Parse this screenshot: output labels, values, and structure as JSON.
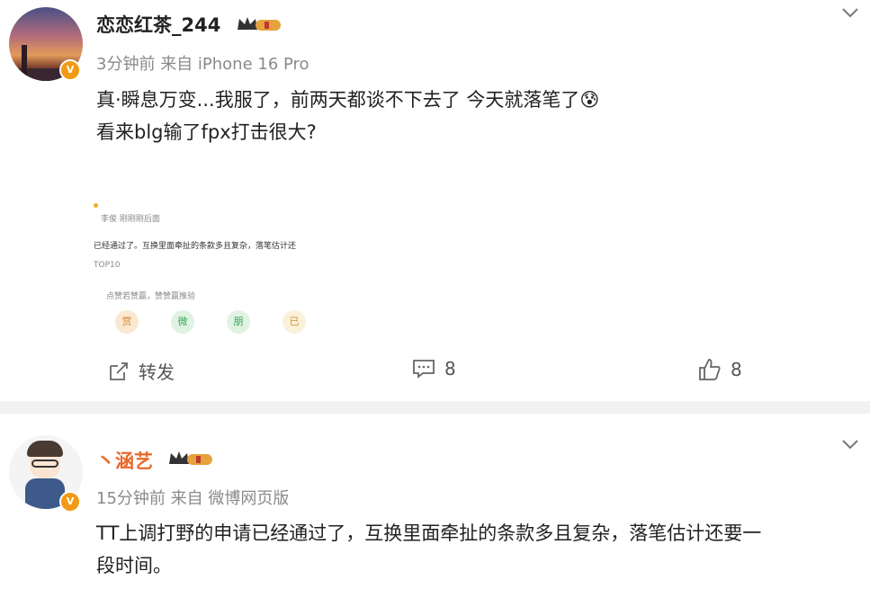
{
  "post1": {
    "username": "恋恋红茶_244",
    "time": "3分钟前",
    "source": "来自 iPhone 16 Pro",
    "line1": "真·瞬息万变...我服了，前两天都谈不下去了 今天就落笔了",
    "line2": "看来blg输了fpx打击很大?",
    "emoji": "😰",
    "thumbnail": {
      "line_a": "李俊 刚刚刚后面",
      "line_b": "已经通过了。互换里面牵扯的条款多且复杂，落笔估计还",
      "line_c": "TOP10",
      "line_d": "点赞若赞赢，赞赞赢推验",
      "icon_labels": [
        "赏",
        "微",
        "朋",
        "已"
      ]
    },
    "repost_label": "转发",
    "comment_count": "8",
    "like_count": "8"
  },
  "post2": {
    "username": "丶涵艺",
    "time": "15分钟前",
    "source": "来自 微博网页版",
    "line1": "TT上调打野的申请已经通过了，互换里面牵扯的条款多且复杂，落笔估计还要一",
    "line2": "段时间。"
  },
  "colors": {
    "verified": "#f29a16",
    "crown": "#e6a23c",
    "name2": "#e9692c"
  }
}
